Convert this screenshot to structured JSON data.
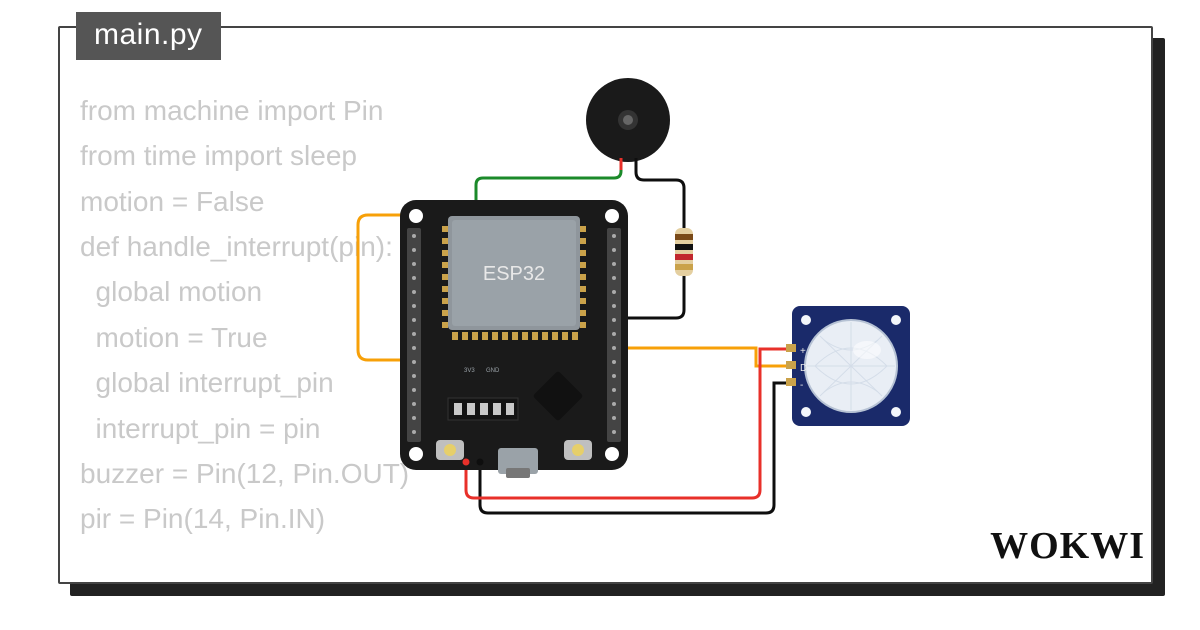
{
  "tab": {
    "label": "main.py"
  },
  "code": {
    "text": "from machine import Pin\nfrom time import sleep\nmotion = False\ndef handle_interrupt(pin):\n  global motion\n  motion = True\n  global interrupt_pin\n  interrupt_pin = pin\nbuzzer = Pin(12, Pin.OUT)\npir = Pin(14, Pin.IN)"
  },
  "brand": {
    "label": "WOKWI"
  },
  "components": {
    "mcu": {
      "label": "ESP32"
    }
  },
  "colors": {
    "tab_bg": "#555555",
    "code_fg": "#c9c9c9",
    "wire_red": "#e8302a",
    "wire_black": "#0e0e0e",
    "wire_orange": "#f7a008",
    "wire_green": "#1b8a2a",
    "board": "#1a1a1a",
    "pir_pcb": "#1a2a6a"
  }
}
